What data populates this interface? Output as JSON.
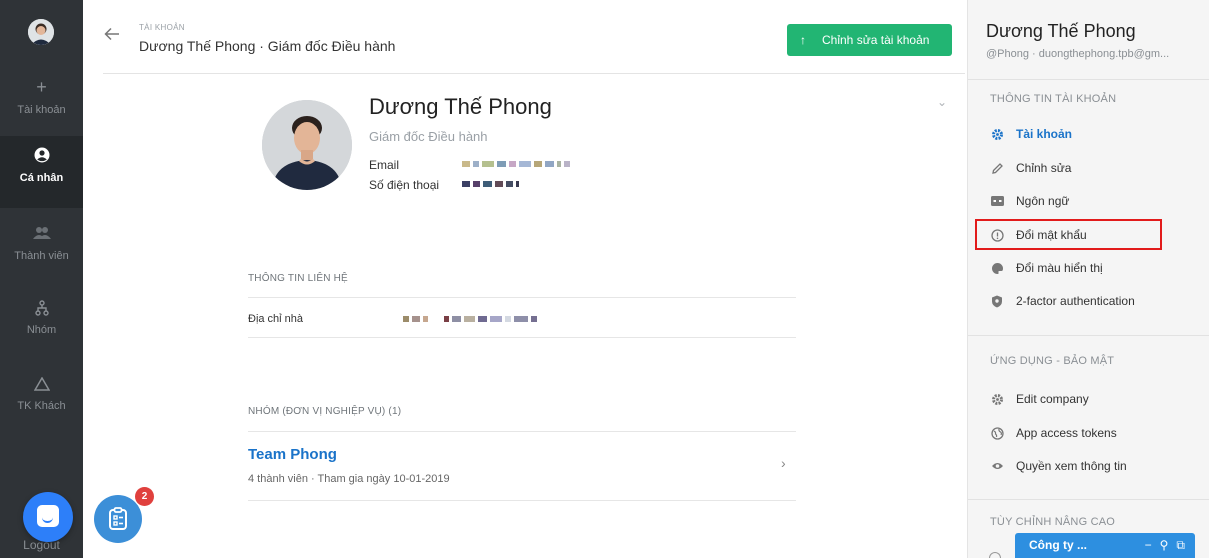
{
  "nav": {
    "items": [
      {
        "label": "Tài khoản",
        "icon": "plus-icon",
        "active": false
      },
      {
        "label": "Cá nhân",
        "icon": "user-circle-icon",
        "active": true
      },
      {
        "label": "Thành viên",
        "icon": "users-icon",
        "active": false
      },
      {
        "label": "Nhóm",
        "icon": "org-chart-icon",
        "active": false
      },
      {
        "label": "TK Khách",
        "icon": "triangle-icon",
        "active": false
      }
    ],
    "logout": "Logout"
  },
  "header": {
    "breadcrumb_small": "TÀI KHOẢN",
    "title": "Dương Thế Phong · Giám đốc Điều hành",
    "edit_button": "Chỉnh sửa tài khoản",
    "edit_button_arrow": "↑"
  },
  "profile": {
    "name": "Dương Thế Phong",
    "role": "Giám đốc Điều hành",
    "email_label": "Email",
    "phone_label": "Số điện thoại"
  },
  "contact": {
    "section_title": "THÔNG TIN LIÊN HỆ",
    "address_label": "Địa chỉ nhà"
  },
  "groups": {
    "section_title": "NHÓM (ĐƠN VỊ NGHIỆP VỤ) (1)",
    "items": [
      {
        "name": "Team Phong",
        "meta": "4 thành viên · Tham gia ngày 10-01-2019"
      }
    ]
  },
  "task_badge": "2",
  "right_panel": {
    "name": "Dương Thế Phong",
    "sub": "@Phong · duongthephong.tpb@gm...",
    "sections": [
      {
        "title": "THÔNG TIN TÀI KHOẢN",
        "items": [
          {
            "label": "Tài khoản",
            "icon": "gear-icon",
            "active": true
          },
          {
            "label": "Chỉnh sửa",
            "icon": "pencil-icon",
            "active": false
          },
          {
            "label": "Ngôn ngữ",
            "icon": "language-icon",
            "active": false
          },
          {
            "label": "Đổi mật khẩu",
            "icon": "alert-circle-icon",
            "active": false
          },
          {
            "label": "Đổi màu hiển thị",
            "icon": "palette-icon",
            "active": false
          },
          {
            "label": "2-factor authentication",
            "icon": "shield-icon",
            "active": false
          }
        ]
      },
      {
        "title": "ỨNG DỤNG - BẢO MẬT",
        "items": [
          {
            "label": "Edit company",
            "icon": "gear-icon",
            "active": false
          },
          {
            "label": "App access tokens",
            "icon": "globe-icon",
            "active": false
          },
          {
            "label": "Quyền xem thông tin",
            "icon": "eye-icon",
            "active": false
          }
        ]
      },
      {
        "title": "TÙY CHỈNH NÂNG CAO",
        "items": []
      }
    ]
  },
  "company_bar": {
    "label": "Công ty ...",
    "tools": [
      "−",
      "⚲",
      "⧉"
    ]
  },
  "colors": {
    "accent_green": "#22b573",
    "link_blue": "#1a73c9",
    "nav_dark": "#2f3337",
    "highlight_red": "#e21b1b"
  }
}
